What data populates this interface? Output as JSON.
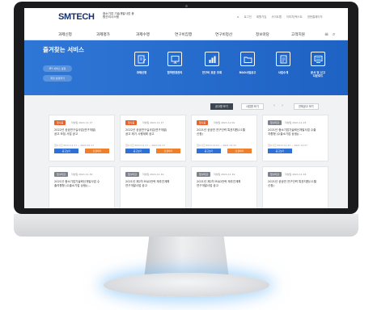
{
  "header": {
    "logo": "SMTECH",
    "logo_sub": "중소기업 기술개발사업 종합관리시스템",
    "util_links": [
      "로그인",
      "회원가입",
      "사이트맵",
      "이미지/텍스트",
      "영문홈페이지"
    ],
    "nav": [
      "과제신청",
      "과제평가",
      "과제수행",
      "연구비집행",
      "연구비정산",
      "정보마당",
      "고객지원"
    ]
  },
  "banner": {
    "title": "즐겨찾는 서비스",
    "pills": [
      "MY 서비스 설정",
      "계정 설정하기"
    ],
    "services": [
      {
        "label": "과제신청",
        "icon": "document-pen-icon"
      },
      {
        "label": "협약변경관리",
        "icon": "monitor-edit-icon"
      },
      {
        "label": "연구비 표준 조회",
        "icon": "chart-icon"
      },
      {
        "label": "R&D사업공고",
        "icon": "folder-icon"
      },
      {
        "label": "사업수계",
        "icon": "document-icon"
      },
      {
        "label": "문서 및 신고\n다운로드",
        "icon": "screen-icon"
      }
    ]
  },
  "filters": {
    "buttons": [
      "공고명 보기",
      "사업명 보기",
      "전체공고 보기"
    ]
  },
  "cards": [
    {
      "status": "접수중",
      "date": "작성일 2021.11.17",
      "title": "2022년 공공연구실사업(연구개발)\n공고 모집 사업 공고",
      "period": "접수기간 2021.11.17 ~ 2022.01.17",
      "btn1": "공고보기",
      "btn2": "신청하기",
      "color": "#e8632b"
    },
    {
      "status": "접수중",
      "date": "작성일 2021.11.17",
      "title": "2022년 공공연구실사업(연구개발)\n공고 제기 시행계획 공고",
      "period": "접수기간 2021.11.17 ~ 2022.01.17",
      "btn1": "공고보기",
      "btn2": "신청하기",
      "color": "#e8632b"
    },
    {
      "status": "접수중",
      "date": "작성일 2021.12.01",
      "title": "2021년 공공연 연구인력 특권지원(11월\n신청)",
      "period": "접수기간 2021.12.01 ~ 2021.12.31",
      "btn1": "공고보기",
      "btn2": "신청하기",
      "color": "#e8632b"
    },
    {
      "status": "접수마감",
      "date": "작성일 2021.11.23",
      "title": "2021년 중소기업기술혁신개발사업 수출\n지향형 (수출소기업 상생)(...",
      "period": "접수기간 2021.11.23 ~ 2021.12.07",
      "btn1": "공고보기",
      "btn2": "",
      "color": "#7d838c"
    },
    {
      "status": "접수마감",
      "date": "작성일 2021.11.30",
      "title": "2021년 중소기업기술혁신개발사업 수\n출지향형 (수출소기업 상생)(...",
      "period": "",
      "btn1": "",
      "btn2": "",
      "color": "#7d838c"
    },
    {
      "status": "접수마감",
      "date": "작성일 2021.11.19",
      "title": "2021년 제2차 R&D전략 재추진계획\n연구개발사업 공고",
      "period": "",
      "btn1": "",
      "btn2": "",
      "color": "#7d838c"
    },
    {
      "status": "접수마감",
      "date": "작성일 2021.11.19",
      "title": "2021년 제2차 R&D전략 재추진계획\n연구개발사업 공고",
      "period": "",
      "btn1": "",
      "btn2": "",
      "color": "#7d838c"
    },
    {
      "status": "접수마감",
      "date": "작성일 2021.11.16",
      "title": "2021년 공공연 연구인력 특권지원(11월\n신청)",
      "period": "",
      "btn1": "",
      "btn2": "",
      "color": "#7d838c"
    }
  ],
  "colors": {
    "brand": "#16306b",
    "banner": "#2f77d6",
    "open": "#e8632b",
    "closed": "#7d838c"
  }
}
